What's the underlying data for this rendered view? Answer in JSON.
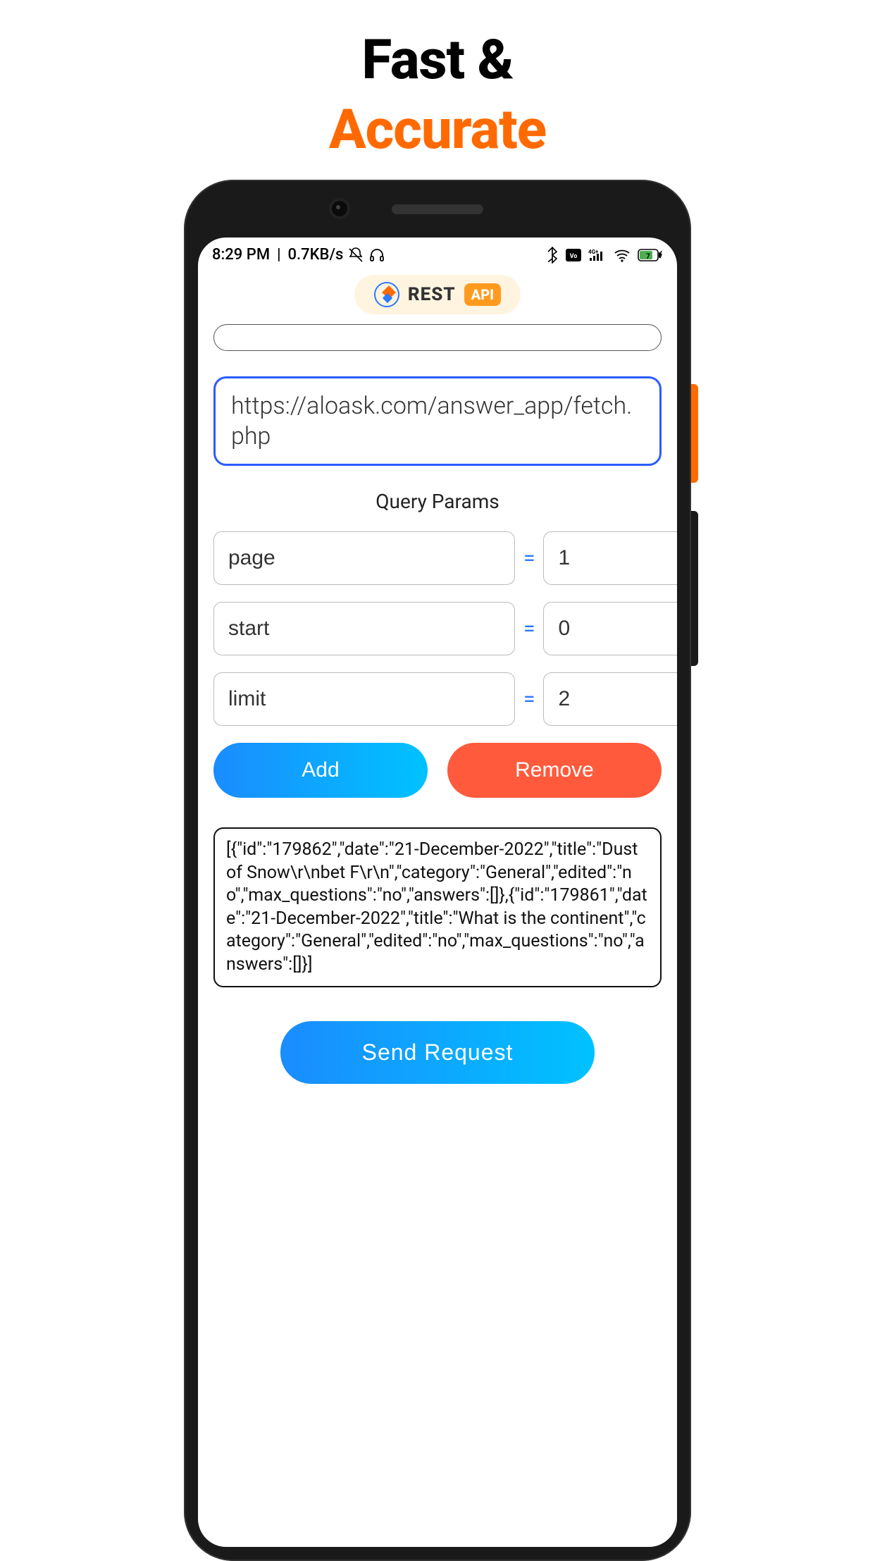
{
  "hero": {
    "line1": "Fast &",
    "line2": "Accurate"
  },
  "status": {
    "time": "8:29 PM",
    "net_speed": "0.7KB/s"
  },
  "app_badge": {
    "brand": "REST",
    "pill": "API"
  },
  "url": "https://aloask.com/answer_app/fetch.php",
  "section_label": "Query Params",
  "params": [
    {
      "key": "page",
      "value": "1"
    },
    {
      "key": "start",
      "value": "0"
    },
    {
      "key": "limit",
      "value": "2"
    }
  ],
  "buttons": {
    "add": "Add",
    "remove": "Remove",
    "send": "Send Request"
  },
  "response_text": "[{\"id\":\"179862\",\"date\":\"21-December-2022\",\"title\":\"Dust of Snow\\r\\nbet F\\r\\n\",\"category\":\"General\",\"edited\":\"no\",\"max_questions\":\"no\",\"answers\":[]},{\"id\":\"179861\",\"date\":\"21-December-2022\",\"title\":\"What is the continent\",\"category\":\"General\",\"edited\":\"no\",\"max_questions\":\"no\",\"answers\":[]}]"
}
